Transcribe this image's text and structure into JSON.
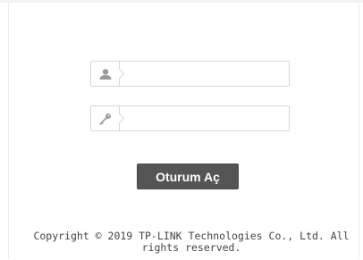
{
  "login_form": {
    "username": {
      "icon": "user-icon",
      "value": "",
      "placeholder": ""
    },
    "password": {
      "icon": "key-icon",
      "value": "",
      "placeholder": ""
    },
    "submit_label": "Oturum Aç"
  },
  "footer": {
    "copyright": "Copyright © 2019 TP-LINK Technologies Co., Ltd. All rights reserved."
  },
  "colors": {
    "button_bg": "#555555",
    "button_text": "#ffffff",
    "field_border": "#d6d6d6",
    "icon": "#9a9a9a"
  }
}
